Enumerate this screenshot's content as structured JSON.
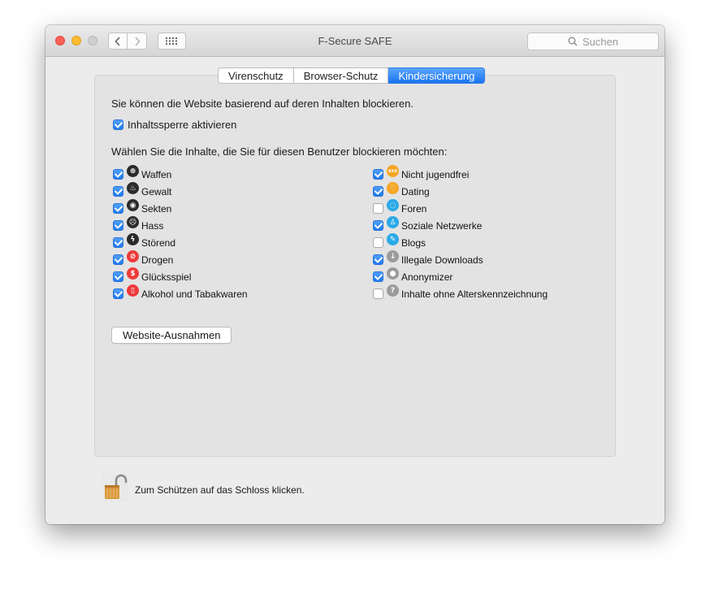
{
  "window": {
    "title": "F-Secure SAFE",
    "search_placeholder": "Suchen"
  },
  "tabs": [
    {
      "label": "Virenschutz",
      "active": false
    },
    {
      "label": "Browser-Schutz",
      "active": false
    },
    {
      "label": "Kindersicherung",
      "active": true
    }
  ],
  "panel": {
    "intro": "Sie können die Website basierend auf deren Inhalten blockieren.",
    "enable_label": "Inhaltssperre aktivieren",
    "enable_checked": true,
    "subheading": "Wählen Sie die Inhalte, die Sie für diesen Benutzer blockieren möchten:",
    "left_categories": [
      {
        "label": "Waffen",
        "checked": true,
        "icon": "crosshair-icon",
        "color": "#2b2b2b"
      },
      {
        "label": "Gewalt",
        "checked": true,
        "icon": "flame-icon",
        "color": "#2b2b2b"
      },
      {
        "label": "Sekten",
        "checked": true,
        "icon": "eye-icon",
        "color": "#2b2b2b"
      },
      {
        "label": "Hass",
        "checked": true,
        "icon": "angry-face-icon",
        "color": "#2b2b2b"
      },
      {
        "label": "Störend",
        "checked": true,
        "icon": "lightning-icon",
        "color": "#2b2b2b"
      },
      {
        "label": "Drogen",
        "checked": true,
        "icon": "pill-icon",
        "color": "#ee3b3b"
      },
      {
        "label": "Glücksspiel",
        "checked": true,
        "icon": "dollar-icon",
        "color": "#ee3b3b"
      },
      {
        "label": "Alkohol und Tabakwaren",
        "checked": true,
        "icon": "bottle-icon",
        "color": "#ee3b3b"
      }
    ],
    "right_categories": [
      {
        "label": "Nicht jugendfrei",
        "checked": true,
        "icon": "xxx-icon",
        "color": "#f5a623"
      },
      {
        "label": "Dating",
        "checked": true,
        "icon": "heart-icon",
        "color": "#f5a623"
      },
      {
        "label": "Foren",
        "checked": false,
        "icon": "chat-bubble-icon",
        "color": "#2aa9e6"
      },
      {
        "label": "Soziale Netzwerke",
        "checked": true,
        "icon": "person-icon",
        "color": "#2aa9e6"
      },
      {
        "label": "Blogs",
        "checked": false,
        "icon": "pencil-icon",
        "color": "#2aa9e6"
      },
      {
        "label": "Illegale Downloads",
        "checked": true,
        "icon": "download-arrow-icon",
        "color": "#9b9b9b"
      },
      {
        "label": "Anonymizer",
        "checked": true,
        "icon": "user-silhouette-icon",
        "color": "#9b9b9b"
      },
      {
        "label": "Inhalte ohne Alterskennzeichnung",
        "checked": false,
        "icon": "question-icon",
        "color": "#9b9b9b"
      }
    ],
    "exceptions_button": "Website-Ausnahmen"
  },
  "footer": {
    "lock_text": "Zum Schützen auf das Schloss klicken.",
    "lock_icon": "padlock-open-icon"
  }
}
